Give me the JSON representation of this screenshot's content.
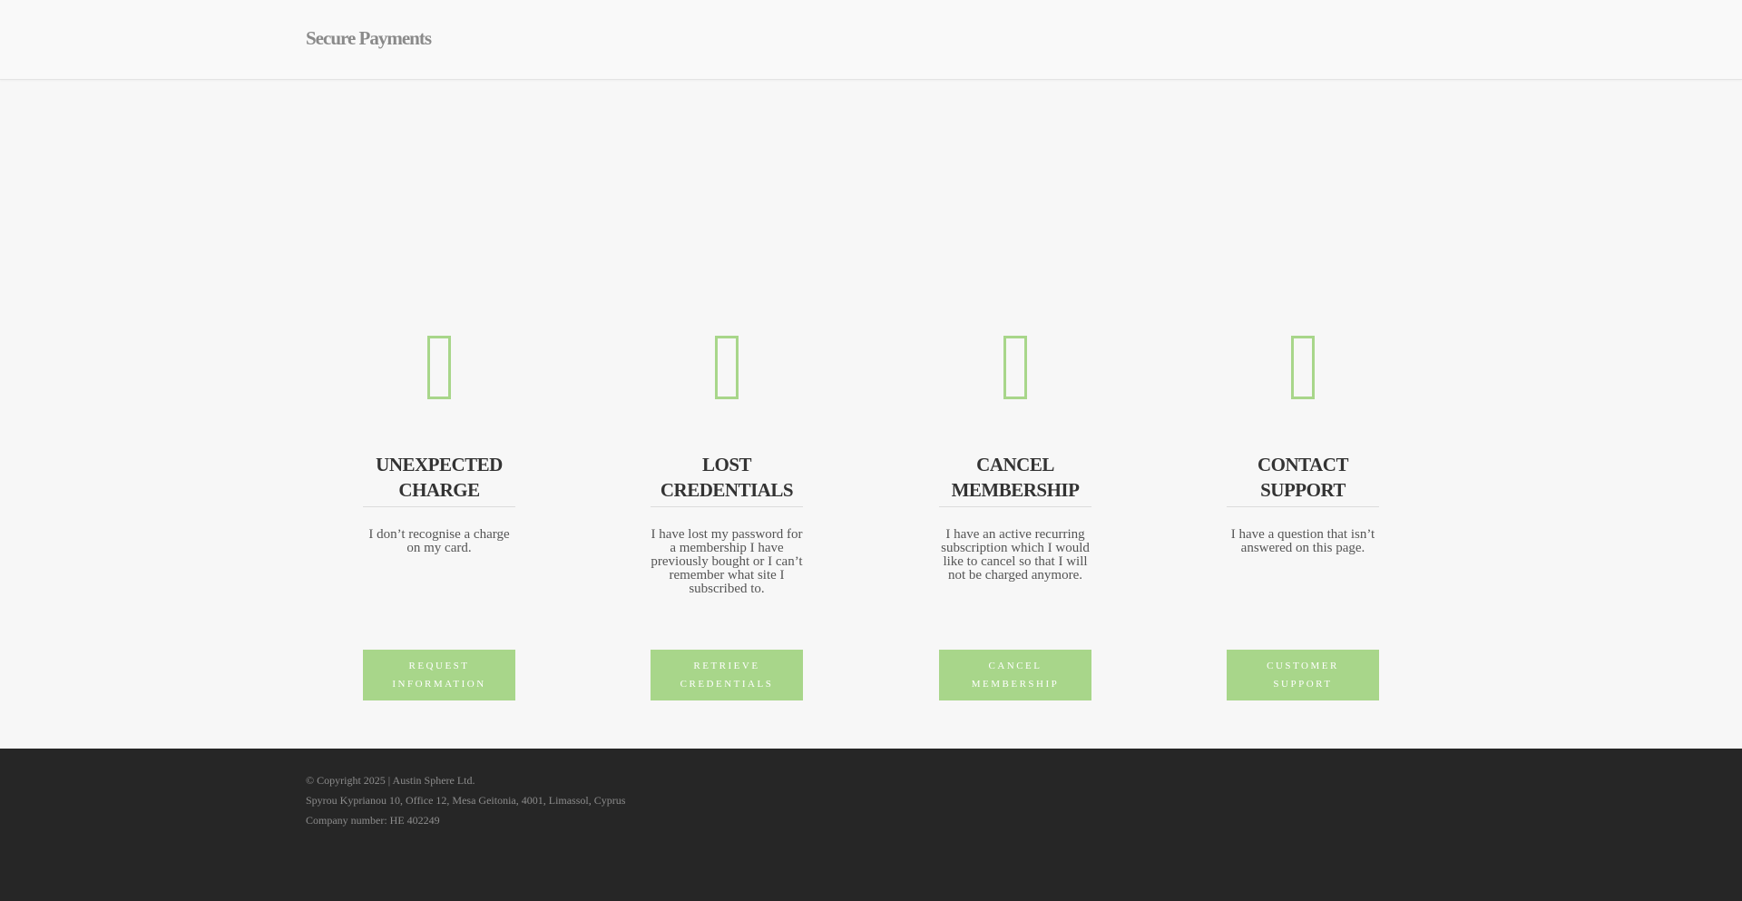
{
  "header": {
    "logo_text": "Secure Payments"
  },
  "cards": [
    {
      "icon": "document-icon",
      "title_line1": "UNEXPECTED",
      "title_line2": "CHARGE",
      "description": "I don’t recognise a charge on my card.",
      "button_line1": "REQUEST",
      "button_line2": "INFORMATION"
    },
    {
      "icon": "key-icon",
      "title_line1": "LOST",
      "title_line2": "CREDENTIALS",
      "description": "I have lost my password for a membership I have previously bought or I can’t remember what site I subscribed to.",
      "button_line1": "RETRIEVE",
      "button_line2": "CREDENTIALS"
    },
    {
      "icon": "cancel-icon",
      "title_line1": "CANCEL",
      "title_line2": "MEMBERSHIP",
      "description": "I have an active recurring subscription which I would like to cancel so that I will not be charged anymore.",
      "button_line1": "CANCEL",
      "button_line2": "MEMBERSHIP"
    },
    {
      "icon": "support-icon",
      "title_line1": "CONTACT",
      "title_line2": "SUPPORT",
      "description": "I have a question that isn’t answered on this page.",
      "button_line1": "CUSTOMER",
      "button_line2": "SUPPORT"
    }
  ],
  "footer": {
    "copyright": "© Copyright 2025 | Austin Sphere Ltd.",
    "address": "Spyrou Kyprianou 10, Office 12, Mesa Geitonia, 4001, Limassol, Cyprus",
    "company_number": "Company number: HE 402249"
  },
  "colors": {
    "accent": "#a8d68a",
    "footer_bg": "#262626",
    "page_bg": "#f7f7f7"
  }
}
